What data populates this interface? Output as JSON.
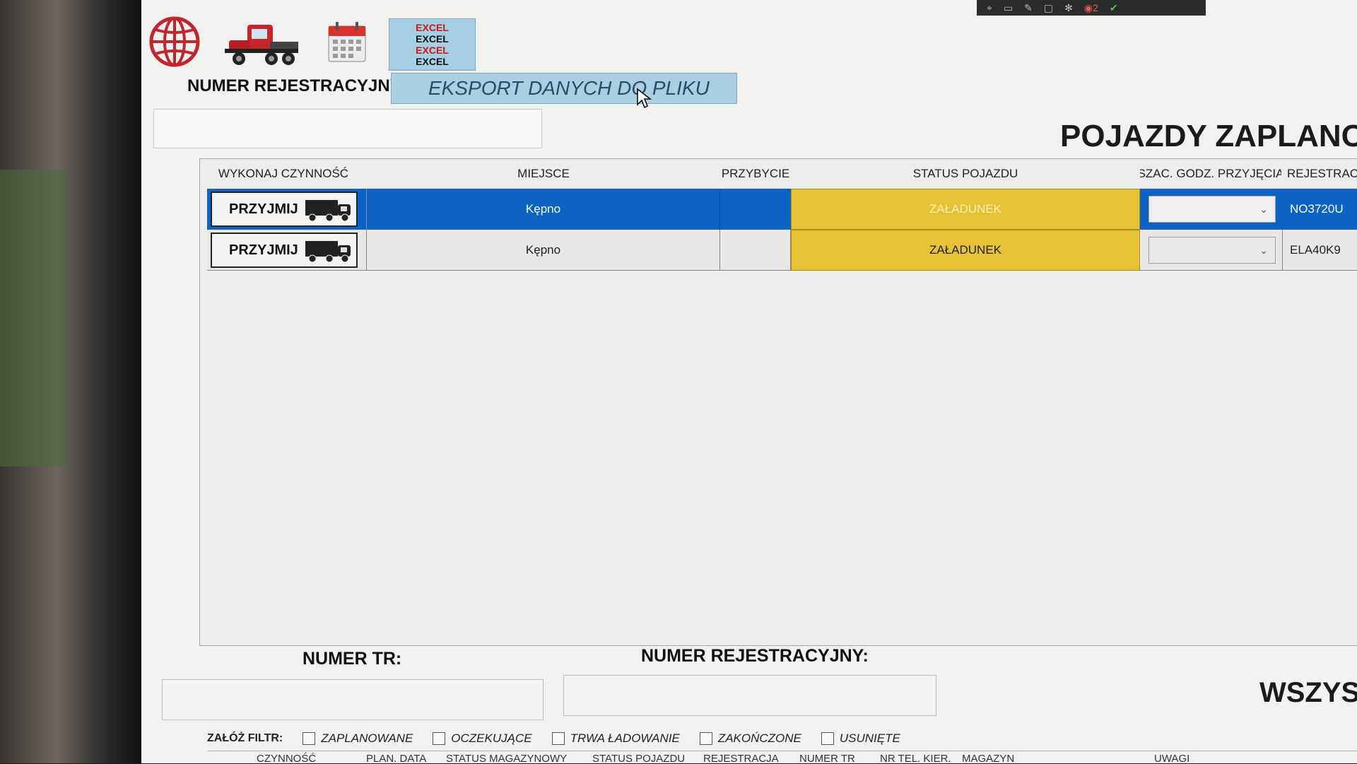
{
  "toolbar": {
    "excel_lines": [
      "EXCEL",
      "EXCEL",
      "EXCEL",
      "EXCEL"
    ],
    "export_label": "EKSPORT DANYCH DO PLIKU"
  },
  "top": {
    "reg_label": "NUMER REJESTRACYJNY",
    "reg_value": "",
    "title": "POJAZDY ZAPLANO"
  },
  "tray": {
    "badge": "2"
  },
  "grid": {
    "headers": [
      "WYKONAJ CZYNNOŚĆ",
      "MIEJSCE",
      "PRZYBYCIE",
      "STATUS POJAZDU",
      "SZAC. GODZ. PRZYJĘCIA",
      "REJESTRAC"
    ],
    "rows": [
      {
        "action": "PRZYJMIJ",
        "miejsce": "Kępno",
        "przybycie": "",
        "status": "ZAŁADUNEK",
        "szac": "",
        "rejestracja": "NO3720U",
        "selected": true
      },
      {
        "action": "PRZYJMIJ",
        "miejsce": "Kępno",
        "przybycie": "",
        "status": "ZAŁADUNEK",
        "szac": "",
        "rejestracja": "ELA40K9",
        "selected": false
      }
    ]
  },
  "bottom": {
    "tr_label": "NUMER TR:",
    "nr_label": "NUMER REJESTRACYJNY:",
    "tr_value": "",
    "nr_value": "",
    "wszys": "WSZYS",
    "filter_label": "ZAŁÓŻ FILTR:",
    "filters": [
      "ZAPLANOWANE",
      "OCZEKUJĄCE",
      "TRWA ŁADOWANIE",
      "ZAKOŃCZONE",
      "USUNIĘTE"
    ],
    "lower_headers": [
      "CZYNNOŚĆ",
      "PLAN. DATA",
      "STATUS MAGAZYNOWY",
      "STATUS POJAZDU",
      "REJESTRACJA",
      "NUMER TR",
      "NR TEL. KIER.",
      "MAGAZYN",
      "UWAGI"
    ]
  },
  "colors": {
    "selected_row": "#0d63c4",
    "status_yellow": "#e7c235",
    "export_bg": "#a9cfe0",
    "excel_red": "#c41b1b"
  },
  "icons": [
    "globe-icon",
    "truck-icon",
    "calendar-icon",
    "excel-icon",
    "delivery-truck-icon",
    "chevron-down-icon"
  ]
}
